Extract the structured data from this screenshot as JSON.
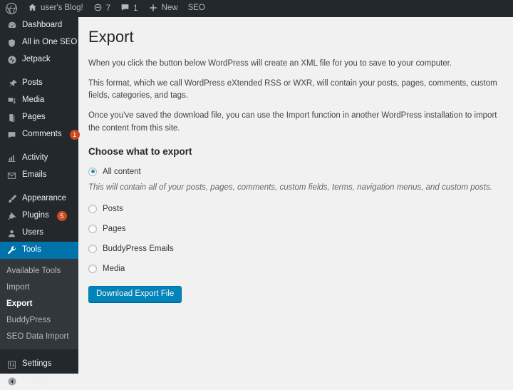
{
  "adminbar": {
    "wp_logo": "wordpress-logo-icon",
    "site_name": "user's Blog!",
    "site_icon": "home-icon",
    "updates": {
      "icon": "updates-icon",
      "count": "7"
    },
    "comments": {
      "icon": "comment-bubble-icon",
      "count": "1"
    },
    "new": {
      "icon": "plus-icon",
      "label": "New"
    },
    "seo": {
      "label": "SEO"
    }
  },
  "sidebar": {
    "items": [
      {
        "label": "Dashboard",
        "icon": "dashboard-icon",
        "badge": ""
      },
      {
        "label": "All in One SEO",
        "icon": "shield-icon",
        "badge": ""
      },
      {
        "label": "Jetpack",
        "icon": "jetpack-icon",
        "badge": ""
      },
      {
        "label": "Posts",
        "icon": "pin-icon",
        "badge": ""
      },
      {
        "label": "Media",
        "icon": "media-icon",
        "badge": ""
      },
      {
        "label": "Pages",
        "icon": "pages-icon",
        "badge": ""
      },
      {
        "label": "Comments",
        "icon": "comment-bubble-icon",
        "badge": "1"
      },
      {
        "label": "Activity",
        "icon": "activity-chart-icon",
        "badge": ""
      },
      {
        "label": "Emails",
        "icon": "envelope-icon",
        "badge": ""
      },
      {
        "label": "Appearance",
        "icon": "paintbrush-icon",
        "badge": ""
      },
      {
        "label": "Plugins",
        "icon": "plug-icon",
        "badge": "5"
      },
      {
        "label": "Users",
        "icon": "user-icon",
        "badge": ""
      },
      {
        "label": "Tools",
        "icon": "wrench-icon",
        "badge": ""
      },
      {
        "label": "Settings",
        "icon": "settings-sliders-icon",
        "badge": ""
      },
      {
        "label": "Collapse menu",
        "icon": "collapse-arrow-icon",
        "badge": ""
      }
    ],
    "submenu": [
      {
        "label": "Available Tools"
      },
      {
        "label": "Import"
      },
      {
        "label": "Export"
      },
      {
        "label": "BuddyPress"
      },
      {
        "label": "SEO Data Import"
      }
    ]
  },
  "main": {
    "title": "Export",
    "paragraphs": [
      "When you click the button below WordPress will create an XML file for you to save to your computer.",
      "This format, which we call WordPress eXtended RSS or WXR, will contain your posts, pages, comments, custom fields, categories, and tags.",
      "Once you've saved the download file, you can use the Import function in another WordPress installation to import the content from this site."
    ],
    "choose_heading": "Choose what to export",
    "options": [
      {
        "label": "All content",
        "checked": true
      },
      {
        "label": "Posts",
        "checked": false
      },
      {
        "label": "Pages",
        "checked": false
      },
      {
        "label": "BuddyPress Emails",
        "checked": false
      },
      {
        "label": "Media",
        "checked": false
      }
    ],
    "all_content_note": "This will contain all of your posts, pages, comments, custom fields, terms, navigation menus, and custom posts.",
    "submit_label": "Download Export File"
  },
  "colors": {
    "admin_bar_bg": "#23282d",
    "menu_bg": "#23282d",
    "submenu_bg": "#32373c",
    "current_menu": "#0073aa",
    "content_bg": "#f1f1f1",
    "badge": "#ca4a1f",
    "button": "#0085ba",
    "radio_dot": "#1e8cbe"
  }
}
